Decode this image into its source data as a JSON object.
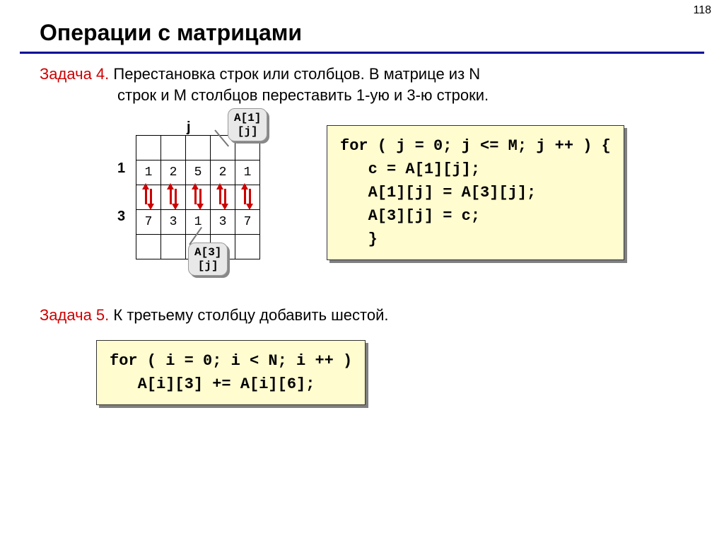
{
  "page_number": "118",
  "title": "Операции с матрицами",
  "task4": {
    "lead": "Задача 4.",
    "line1": " Перестановка строк или столбцов. В матрице из N",
    "line2": "строк и M столбцов переставить 1-ую и 3-ю строки."
  },
  "matrix": {
    "j_label": "j",
    "row1_label": "1",
    "row3_label": "3",
    "rows": [
      [
        "",
        "",
        "",
        "",
        ""
      ],
      [
        "1",
        "2",
        "5",
        "2",
        "1"
      ],
      [
        "",
        "",
        "",
        "",
        ""
      ],
      [
        "7",
        "3",
        "1",
        "3",
        "7"
      ],
      [
        "",
        "",
        "",
        "",
        ""
      ]
    ],
    "callout_top": "A[1]\n[j]",
    "callout_bot": "A[3]\n[j]"
  },
  "code1": "for ( j = 0; j <= M; j ++ ) {\n   c = A[1][j];\n   A[1][j] = A[3][j];\n   A[3][j] = c;\n   }",
  "task5": {
    "lead": "Задача 5.",
    "text": " К третьему столбцу добавить шестой."
  },
  "code2": "for ( i = 0; i < N; i ++ )\n   A[i][3] += A[i][6];"
}
